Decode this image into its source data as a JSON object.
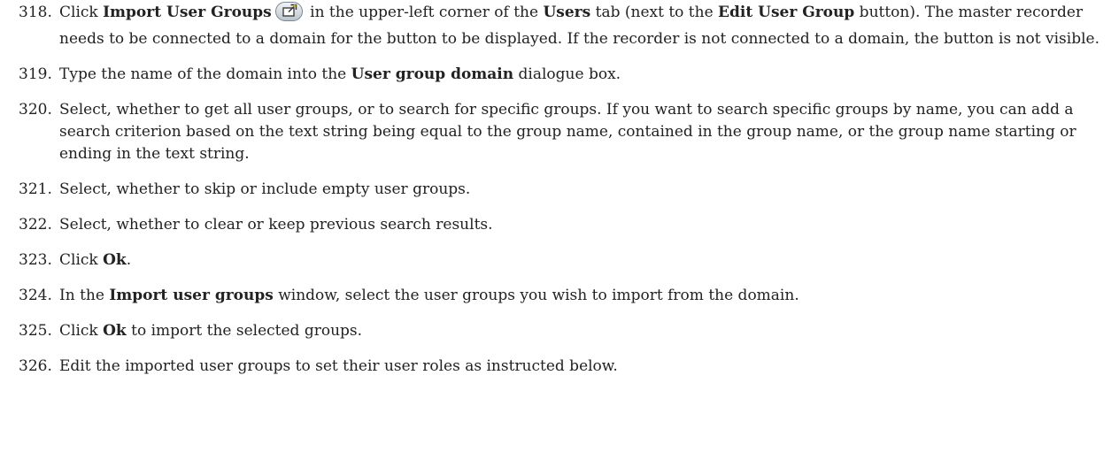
{
  "steps": [
    {
      "number": "318.",
      "parts": [
        {
          "t": "Click "
        },
        {
          "t": "Import User Groups",
          "b": true
        },
        {
          "icon": "import-user-groups-icon"
        },
        {
          "t": " in the upper-left corner of the "
        },
        {
          "t": "Users",
          "b": true
        },
        {
          "t": " tab (next to the "
        },
        {
          "t": "Edit User Group",
          "b": true
        },
        {
          "t": " button). The master recorder needs to be connected to a domain for the button to be displayed. If the recorder is not connected to a domain, the button is not visible."
        }
      ]
    },
    {
      "number": "319.",
      "parts": [
        {
          "t": "Type the name of the domain into the "
        },
        {
          "t": "User group domain",
          "b": true
        },
        {
          "t": " dialogue box."
        }
      ]
    },
    {
      "number": "320.",
      "parts": [
        {
          "t": "Select, whether to get all user groups, or to search for specific groups. If you want to search specific groups by name, you can add a search criterion based on the text string being equal to the group name, contained in the group name, or the group name starting or ending in the text string."
        }
      ]
    },
    {
      "number": "321.",
      "parts": [
        {
          "t": "Select, whether to skip or include empty user groups."
        }
      ]
    },
    {
      "number": "322.",
      "parts": [
        {
          "t": "Select, whether to clear or keep previous search results."
        }
      ]
    },
    {
      "number": "323.",
      "parts": [
        {
          "t": "Click "
        },
        {
          "t": "Ok",
          "b": true
        },
        {
          "t": "."
        }
      ]
    },
    {
      "number": "324.",
      "parts": [
        {
          "t": "In the "
        },
        {
          "t": "Import user groups",
          "b": true
        },
        {
          "t": " window, select the user groups you wish to import from the domain."
        }
      ]
    },
    {
      "number": "325.",
      "parts": [
        {
          "t": "Click "
        },
        {
          "t": "Ok",
          "b": true
        },
        {
          "t": " to import the selected groups."
        }
      ]
    },
    {
      "number": "326.",
      "parts": [
        {
          "t": "Edit the imported user groups to set their user roles as instructed below."
        }
      ]
    }
  ]
}
